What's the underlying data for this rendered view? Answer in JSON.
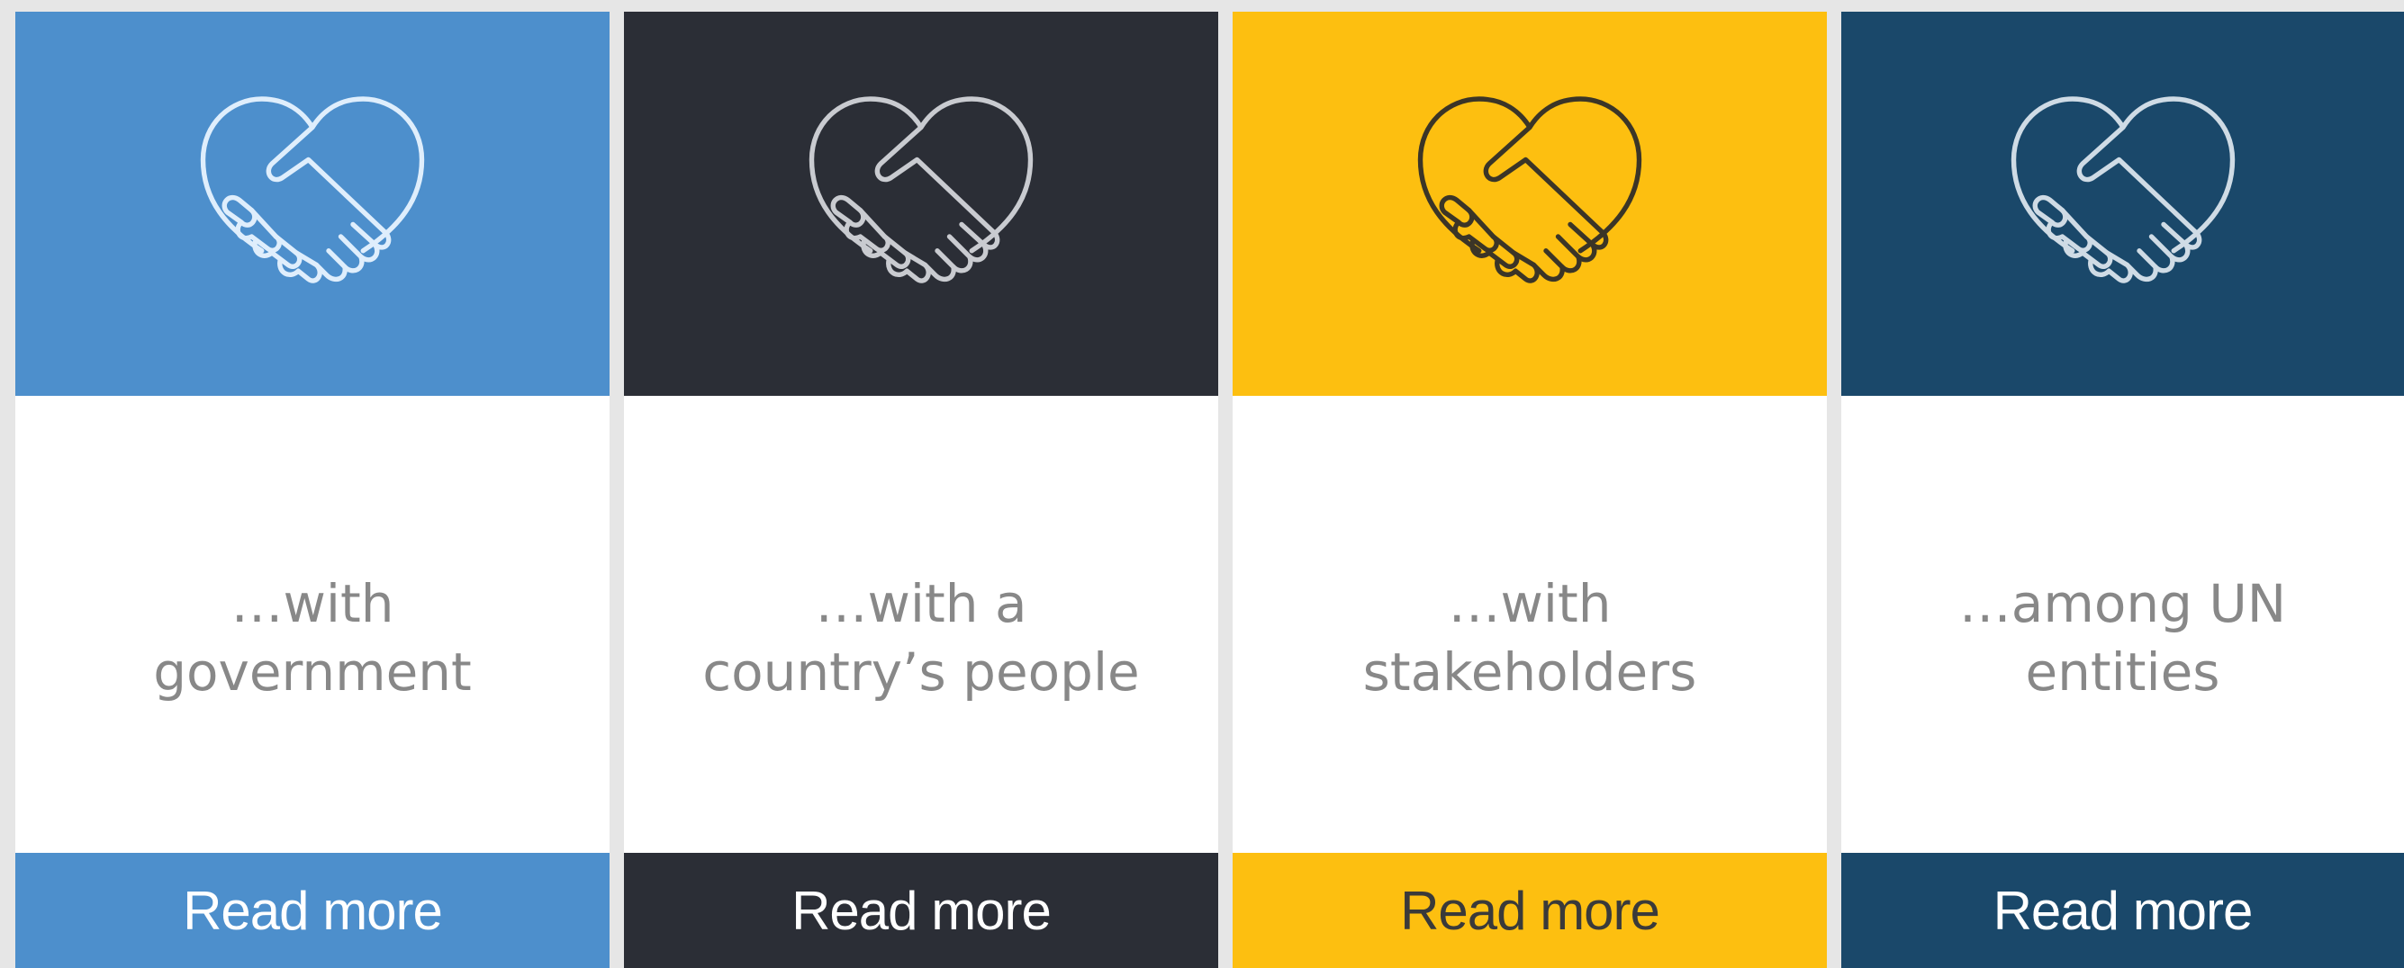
{
  "cards": [
    {
      "text_line1": "…with",
      "text_line2": "government",
      "button_label": "Read more",
      "color": "#4d8fcc",
      "icon_color": "#dfeefc",
      "button_text_color": "#ffffff",
      "icon": "heart-handshake-icon"
    },
    {
      "text_line1": "…with a",
      "text_line2": "country’s people",
      "button_label": "Read more",
      "color": "#2b2e36",
      "icon_color": "#c9cbd0",
      "button_text_color": "#ffffff",
      "icon": "heart-handshake-icon"
    },
    {
      "text_line1": "…with",
      "text_line2": "stakeholders",
      "button_label": "Read more",
      "color": "#fdbf10",
      "icon_color": "#3b3527",
      "button_text_color": "#3a3a3a",
      "icon": "heart-handshake-icon"
    },
    {
      "text_line1": "…among UN",
      "text_line2": "entities",
      "button_label": "Read more",
      "color": "#1a486a",
      "icon_color": "#cfdbe5",
      "button_text_color": "#ffffff",
      "icon": "heart-handshake-icon"
    }
  ]
}
